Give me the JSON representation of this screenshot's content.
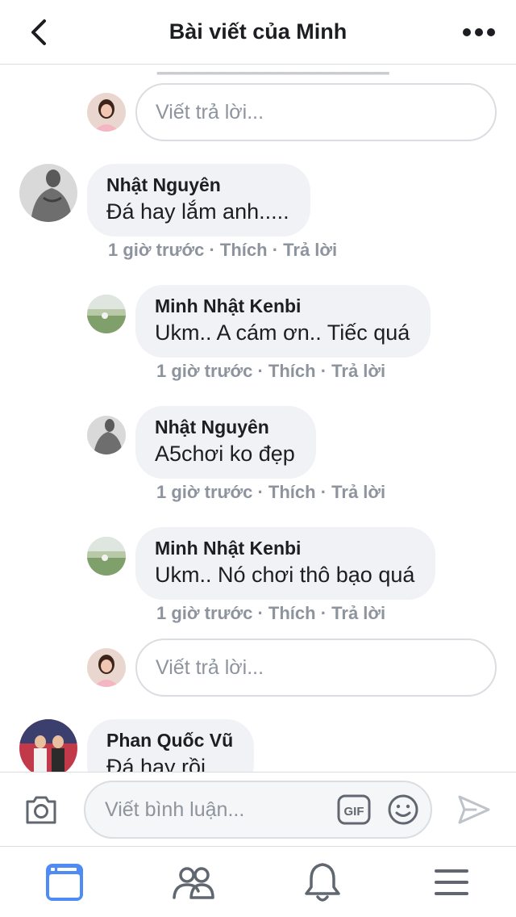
{
  "header": {
    "title": "Bài viết của Minh"
  },
  "thread": {
    "reply_placeholder": "Viết trả lời...",
    "comments": [
      {
        "author": "Nhật Nguyên",
        "text": "Đá hay lắm anh.....",
        "time": "1 giờ trước",
        "like": "Thích",
        "reply": "Trả lời"
      }
    ],
    "replies": [
      {
        "author": "Minh Nhật Kenbi",
        "text": "Ukm.. A cám ơn.. Tiếc quá",
        "time": "1 giờ trước",
        "like": "Thích",
        "reply": "Trả lời"
      },
      {
        "author": "Nhật Nguyên",
        "text": "A5chơi ko đẹp",
        "time": "1 giờ trước",
        "like": "Thích",
        "reply": "Trả lời"
      },
      {
        "author": "Minh Nhật Kenbi",
        "text": "Ukm.. Nó chơi thô bạo quá",
        "time": "1 giờ trước",
        "like": "Thích",
        "reply": "Trả lời"
      }
    ],
    "last_comment": {
      "author": "Phan Quốc Vũ",
      "text": "Đá hay rồi"
    }
  },
  "meta_separator": " · ",
  "composer": {
    "placeholder": "Viết bình luận...",
    "gif_label": "GIF"
  },
  "icons": {
    "back": "chevron-left-icon",
    "more": "more-icon",
    "camera": "camera-icon",
    "gif": "gif-icon",
    "emoji": "emoji-icon",
    "send": "send-icon",
    "tab_feed": "news-feed-icon",
    "tab_groups": "groups-icon",
    "tab_notifications": "bell-icon",
    "tab_menu": "menu-icon"
  },
  "colors": {
    "accent": "#4e8bf5",
    "bubble": "#f0f2f5",
    "secondary_text": "#8d949e",
    "border": "#dadde1"
  }
}
